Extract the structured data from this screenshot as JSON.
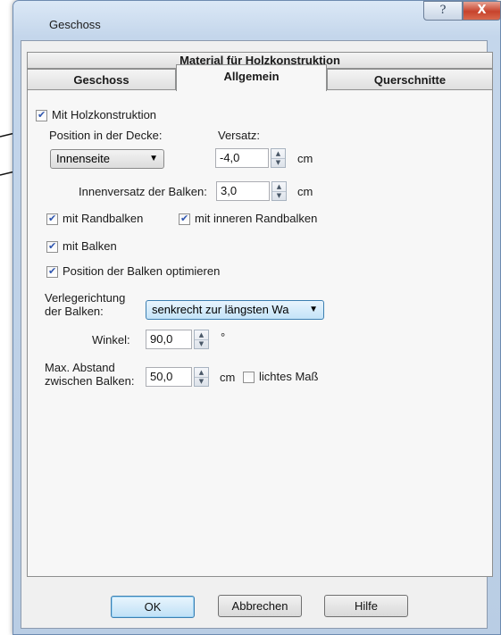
{
  "window": {
    "title": "Geschoss",
    "help_glyph": "?",
    "close_glyph": "X"
  },
  "tabs": {
    "top": "Material für Holzkonstruktion",
    "geschoss": "Geschoss",
    "allgemein": "Allgemein",
    "querschnitte": "Querschnitte"
  },
  "form": {
    "mit_holzkonstruktion": "Mit Holzkonstruktion",
    "position_label": "Position in der Decke:",
    "position_value": "Innenseite",
    "versatz_label": "Versatz:",
    "versatz_value": "-4,0",
    "unit_cm": "cm",
    "innenversatz_label": "Innenversatz der Balken:",
    "innenversatz_value": "3,0",
    "mit_randbalken": "mit Randbalken",
    "mit_inneren_randbalken": "mit inneren Randbalken",
    "mit_balken": "mit Balken",
    "position_optimieren": "Position der Balken optimieren",
    "verlegerichtung_label_1": "Verlegerichtung",
    "verlegerichtung_label_2": "der Balken:",
    "verlegerichtung_value": "senkrecht zur längsten Wa",
    "winkel_label": "Winkel:",
    "winkel_value": "90,0",
    "degree_unit": "°",
    "abstand_label_1": "Max. Abstand",
    "abstand_label_2": "zwischen Balken:",
    "abstand_value": "50,0",
    "lichtes_mass": "lichtes Maß"
  },
  "buttons": {
    "ok": "OK",
    "abbrechen": "Abbrechen",
    "hilfe": "Hilfe"
  }
}
